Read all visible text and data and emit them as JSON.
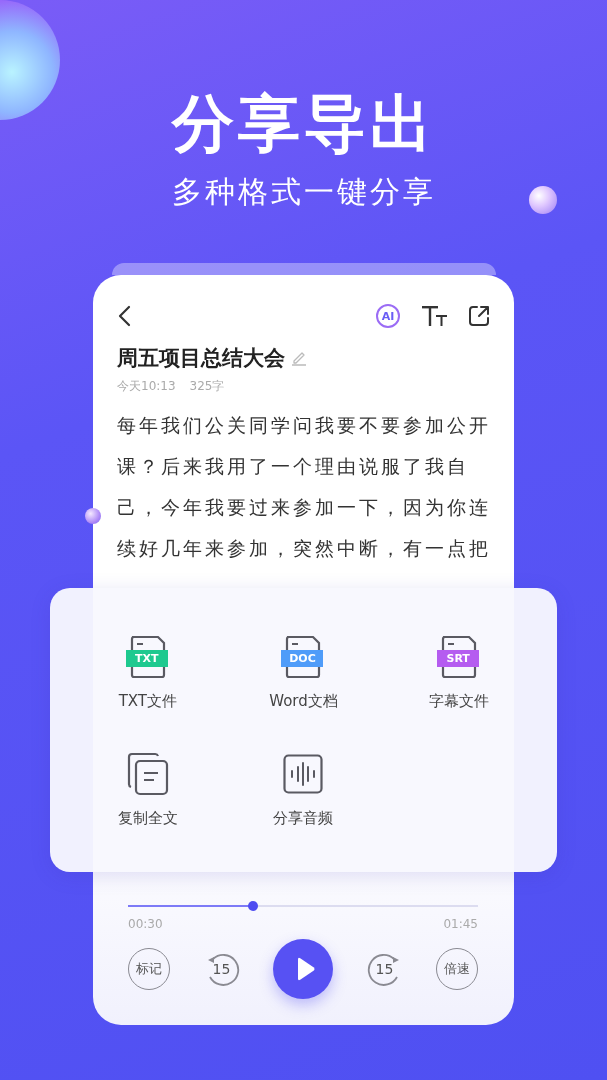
{
  "header": {
    "title": "分享导出",
    "subtitle": "多种格式一键分享"
  },
  "note": {
    "ai_badge": "AI",
    "title": "周五项目总结大会",
    "date": "今天10:13",
    "word_count": "325字",
    "body": "每年我们公关同学问我要不要参加公开课？后来我用了一个理由说服了我自己，今年我要过来参加一下，因为你连续好几年来参加，突然中断，有一点把"
  },
  "share_panel": {
    "items": [
      {
        "kind": "file",
        "badge": "TXT",
        "color": "#1ec98f",
        "label": "TXT文件"
      },
      {
        "kind": "file",
        "badge": "DOC",
        "color": "#4f9cf9",
        "label": "Word文档"
      },
      {
        "kind": "file",
        "badge": "SRT",
        "color": "#b55cf0",
        "label": "字幕文件"
      },
      {
        "kind": "copy",
        "label": "复制全文"
      },
      {
        "kind": "audio",
        "label": "分享音频"
      }
    ]
  },
  "player": {
    "elapsed": "00:30",
    "duration": "01:45",
    "level": 0.357,
    "playing": false,
    "buttons": [
      {
        "kind": "text",
        "label": "标记"
      },
      {
        "kind": "back",
        "label": "15"
      },
      {
        "kind": "play"
      },
      {
        "kind": "forward",
        "label": "15"
      },
      {
        "kind": "text",
        "label": "倍速"
      }
    ]
  }
}
